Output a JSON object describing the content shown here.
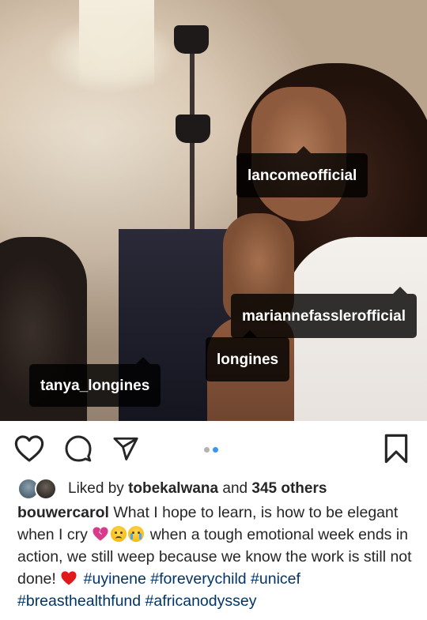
{
  "post": {
    "tags": [
      {
        "username": "lancomeofficial"
      },
      {
        "username": "mariannefasslerofficial"
      },
      {
        "username": "longines"
      },
      {
        "username": "tanya_longines"
      }
    ],
    "likes": {
      "prefix": "Liked by",
      "liker": "tobekalwana",
      "joiner": "and",
      "others": "345 others"
    },
    "caption": {
      "username": "bouwercarol",
      "text_part_1": "What I hope to learn, is how to be elegant when I cry",
      "text_part_2": "when a tough emotional week ends in action, we still weep because we know the work is still not done!",
      "hashtags": [
        "#uyinene",
        "#foreverychild",
        "#unicef",
        "#breasthealthfund",
        "#africanodyssey"
      ]
    },
    "carousel": {
      "current": 2,
      "total": 2
    },
    "colors": {
      "accent": "#3897f0",
      "hashtag": "#003569",
      "text": "#262626",
      "tag_bg": "#000000"
    },
    "icons": [
      "heart-outline-icon",
      "comment-bubble-icon",
      "paper-plane-icon",
      "bookmark-icon",
      "broken-heart-emoji",
      "sad-face-emoji",
      "crying-face-emoji",
      "red-heart-emoji"
    ]
  }
}
